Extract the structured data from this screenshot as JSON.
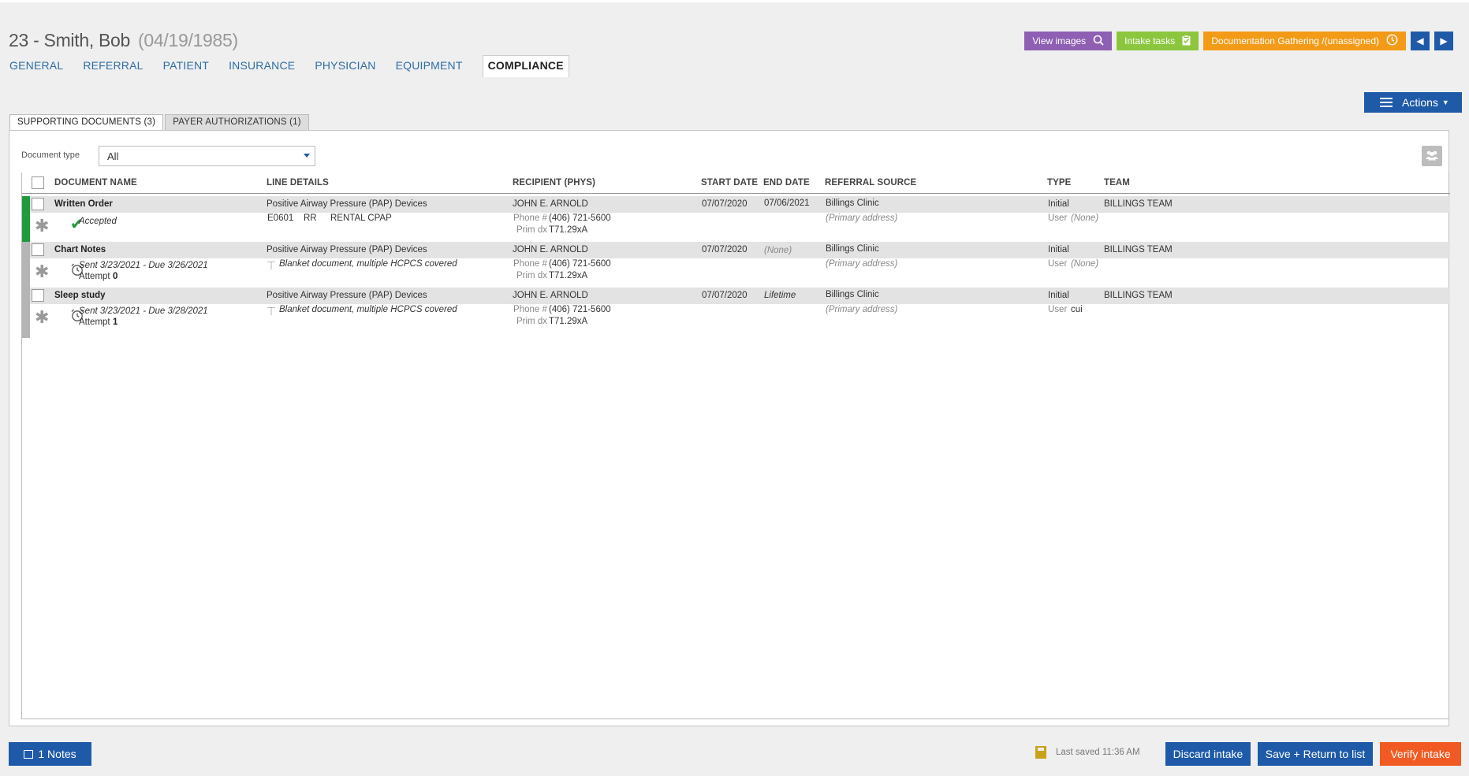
{
  "header": {
    "patient_name": "23 - Smith, Bob",
    "dob": "(04/19/1985)"
  },
  "nav_tabs": [
    "GENERAL",
    "REFERRAL",
    "PATIENT",
    "INSURANCE",
    "PHYSICIAN",
    "EQUIPMENT",
    "COMPLIANCE"
  ],
  "top_buttons": {
    "view_images": "View images",
    "intake_tasks": "Intake tasks",
    "documentation": "Documentation Gathering /(unassigned)"
  },
  "actions_label": "Actions",
  "sub_tabs": [
    "SUPPORTING DOCUMENTS (3)",
    "PAYER AUTHORIZATIONS (1)"
  ],
  "filter": {
    "label": "Document type",
    "value": "All"
  },
  "columns": {
    "doc_name": "DOCUMENT NAME",
    "line_details": "LINE DETAILS",
    "recipient": "RECIPIENT (PHYS)",
    "start_date": "START DATE",
    "end_date": "END DATE",
    "referral_source": "REFERRAL SOURCE",
    "type": "TYPE",
    "team": "TEAM"
  },
  "rows": [
    {
      "name": "Written Order",
      "status": "Accepted",
      "status_color": "#1f9a3c",
      "line": "Positive Airway Pressure (PAP) Devices",
      "line_code": "E0601",
      "line_mod": "RR",
      "line_desc": "RENTAL CPAP",
      "recipient": "JOHN E. ARNOLD",
      "phone_label": "Phone #",
      "phone": "(406) 721-5600",
      "dx_label": "Prim dx",
      "dx": "T71.29xA",
      "start": "07/07/2020",
      "end": "07/06/2021",
      "referral": "Billings Clinic",
      "referral_addr": "(Primary address)",
      "type": "Initial",
      "user_label": "User",
      "user": "(None)",
      "team": "BILLINGS TEAM"
    },
    {
      "name": "Chart Notes",
      "status_color": "#b5b5b5",
      "sent": "Sent 3/23/2021 - Due 3/26/2021",
      "attempt_label": "Attempt",
      "attempt": "0",
      "line": "Positive Airway Pressure (PAP) Devices",
      "line_desc": "Blanket document, multiple HCPCS covered",
      "recipient": "JOHN E. ARNOLD",
      "phone_label": "Phone #",
      "phone": "(406) 721-5600",
      "dx_label": "Prim dx",
      "dx": "T71.29xA",
      "start": "07/07/2020",
      "end": "(None)",
      "referral": "Billings Clinic",
      "referral_addr": "(Primary address)",
      "type": "Initial",
      "user_label": "User",
      "user": "(None)",
      "team": "BILLINGS TEAM"
    },
    {
      "name": "Sleep study",
      "status_color": "#b5b5b5",
      "sent": "Sent 3/23/2021 - Due 3/28/2021",
      "attempt_label": "Attempt",
      "attempt": "1",
      "line": "Positive Airway Pressure (PAP) Devices",
      "line_desc": "Blanket document, multiple HCPCS covered",
      "recipient": "JOHN E. ARNOLD",
      "phone_label": "Phone #",
      "phone": "(406) 721-5600",
      "dx_label": "Prim dx",
      "dx": "T71.29xA",
      "start": "07/07/2020",
      "end": "Lifetime",
      "referral": "Billings Clinic",
      "referral_addr": "(Primary address)",
      "type": "Initial",
      "user_label": "User",
      "user": "cui",
      "team": "BILLINGS TEAM"
    }
  ],
  "footer": {
    "notes": "1 Notes",
    "last_saved": "Last saved 11:36 AM",
    "discard": "Discard intake",
    "save_return": "Save + Return to list",
    "verify": "Verify intake"
  }
}
